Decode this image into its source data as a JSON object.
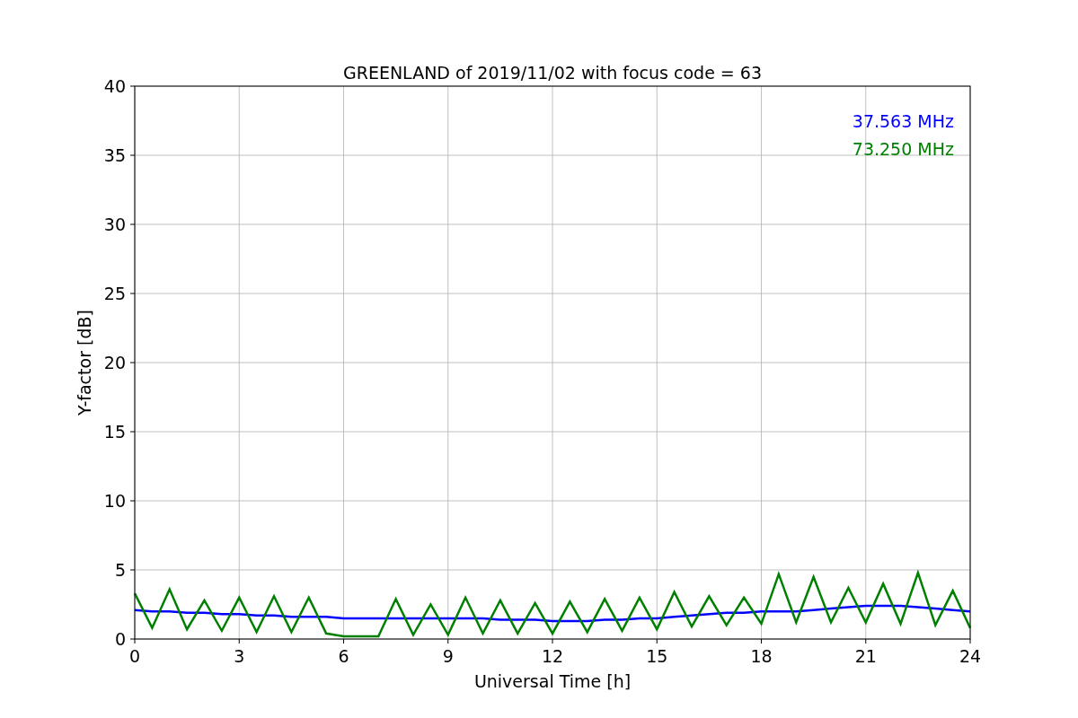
{
  "chart_data": {
    "type": "line",
    "title": "GREENLAND of 2019/11/02 with focus code = 63",
    "xlabel": "Universal Time [h]",
    "ylabel": "Y-factor [dB]",
    "x": [
      0,
      0.5,
      1,
      1.5,
      2,
      2.5,
      3,
      3.5,
      4,
      4.5,
      5,
      5.5,
      6,
      6.5,
      7,
      7.5,
      8,
      8.5,
      9,
      9.5,
      10,
      10.5,
      11,
      11.5,
      12,
      12.5,
      13,
      13.5,
      14,
      14.5,
      15,
      15.5,
      16,
      16.5,
      17,
      17.5,
      18,
      18.5,
      19,
      19.5,
      20,
      20.5,
      21,
      21.5,
      22,
      22.5,
      23,
      23.5,
      24
    ],
    "series": [
      {
        "name": "37.563 MHz",
        "color": "#0000ff",
        "values": [
          2.1,
          2.0,
          2.0,
          1.9,
          1.9,
          1.8,
          1.8,
          1.7,
          1.7,
          1.6,
          1.6,
          1.6,
          1.5,
          1.5,
          1.5,
          1.5,
          1.5,
          1.5,
          1.5,
          1.5,
          1.5,
          1.4,
          1.4,
          1.4,
          1.3,
          1.3,
          1.3,
          1.4,
          1.4,
          1.5,
          1.5,
          1.6,
          1.7,
          1.8,
          1.9,
          1.9,
          2.0,
          2.0,
          2.0,
          2.1,
          2.2,
          2.3,
          2.4,
          2.4,
          2.4,
          2.3,
          2.2,
          2.1,
          2.0
        ]
      },
      {
        "name": "73.250 MHz",
        "color": "#008000",
        "values": [
          3.3,
          0.8,
          3.6,
          0.7,
          2.8,
          0.6,
          3.0,
          0.5,
          3.1,
          0.5,
          3.0,
          0.4,
          0.2,
          0.2,
          0.2,
          2.9,
          0.3,
          2.5,
          0.3,
          3.0,
          0.4,
          2.8,
          0.4,
          2.6,
          0.4,
          2.7,
          0.5,
          2.9,
          0.6,
          3.0,
          0.7,
          3.4,
          0.9,
          3.1,
          1.0,
          3.0,
          1.1,
          4.7,
          1.2,
          4.5,
          1.2,
          3.7,
          1.2,
          4.0,
          1.1,
          4.8,
          1.0,
          3.5,
          0.8
        ]
      }
    ],
    "xlim": [
      0,
      24
    ],
    "ylim": [
      0,
      40
    ],
    "xticks": [
      0,
      3,
      6,
      9,
      12,
      15,
      18,
      21,
      24
    ],
    "yticks": [
      0,
      5,
      10,
      15,
      20,
      25,
      30,
      35,
      40
    ],
    "grid": true
  }
}
